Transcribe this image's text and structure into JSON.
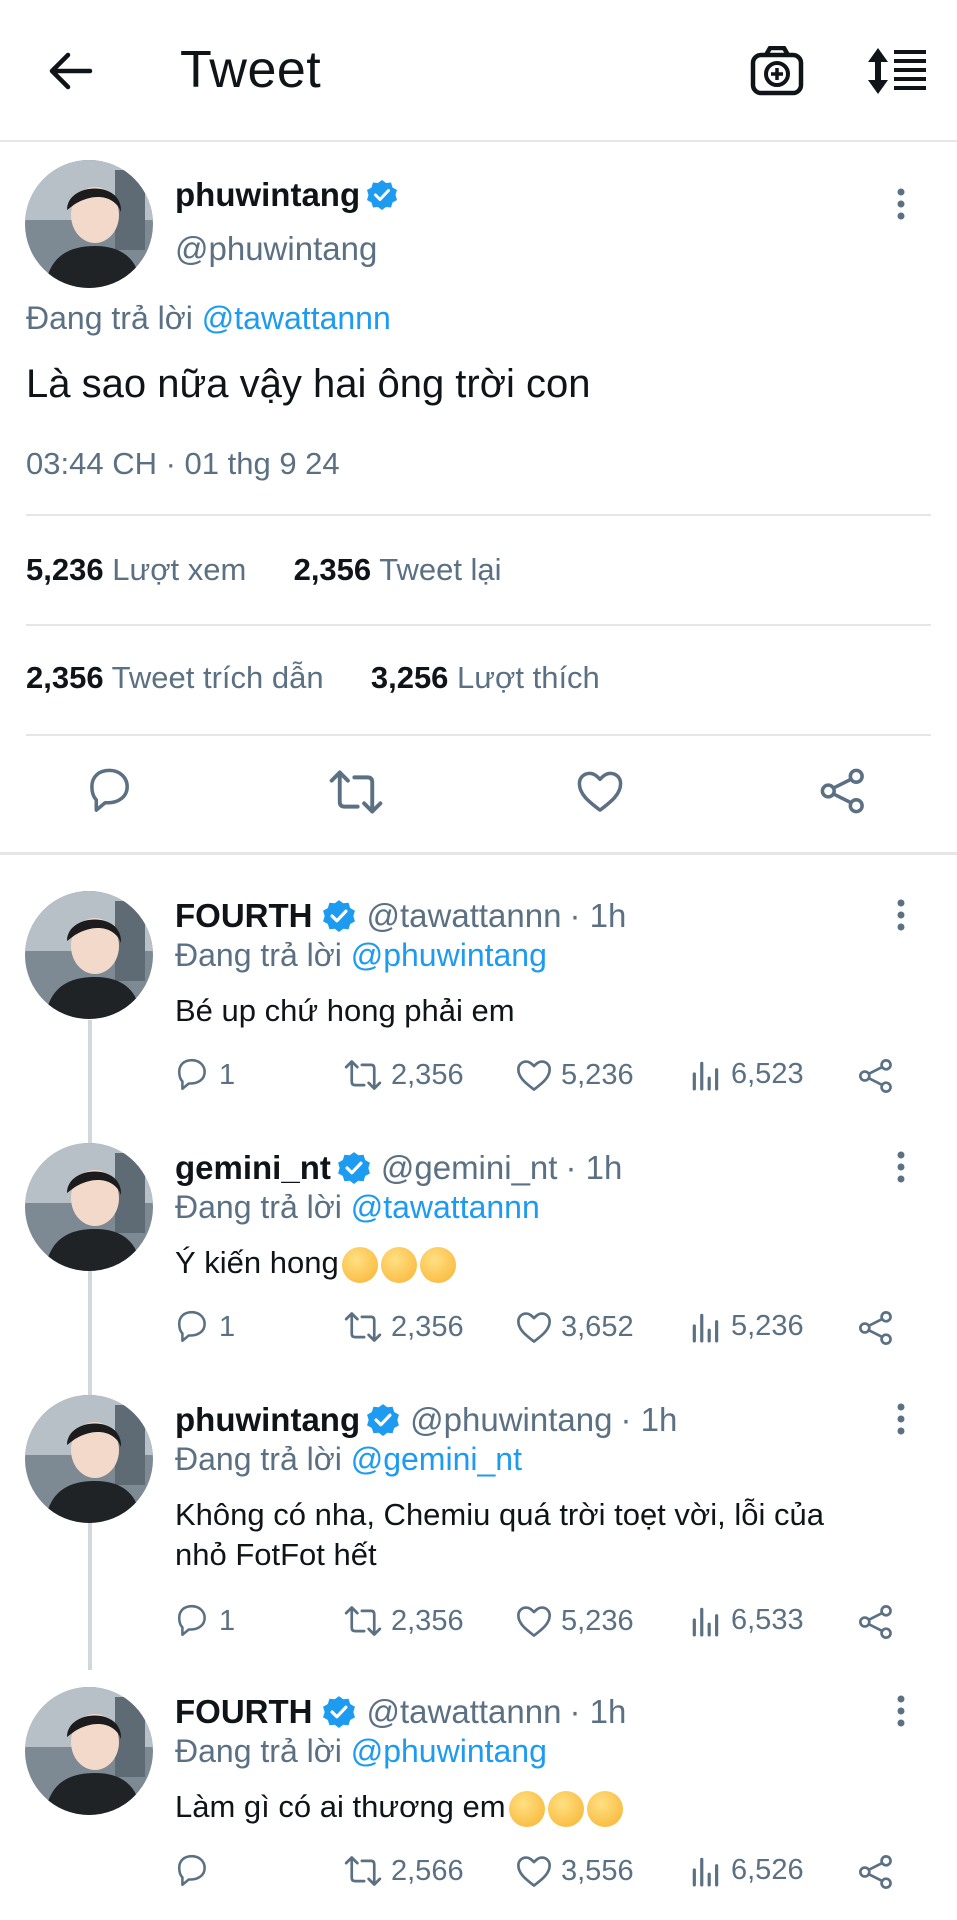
{
  "header": {
    "title": "Tweet",
    "icons": [
      "back-arrow-icon",
      "camera-plus-icon",
      "sort-icon"
    ]
  },
  "colors": {
    "accent": "#1d9bf0",
    "text": "#0f1419",
    "muted": "#5b7083",
    "divider": "#e6e6e6"
  },
  "main_tweet": {
    "name": "phuwintang",
    "handle": "@phuwintang",
    "replying_prefix": "Đang trả lời",
    "replying_to": "@tawattannn",
    "text": "Là sao nữa vậy hai ông trời con",
    "timestamp": "03:44 CH · 01 thg 9 24",
    "stats": {
      "views_count": "5,236",
      "views_label": "Lượt xem",
      "retweets_count": "2,356",
      "retweets_label": "Tweet lại",
      "quotes_count": "2,356",
      "quotes_label": "Tweet trích dẫn",
      "likes_count": "3,256",
      "likes_label": "Lượt thích"
    }
  },
  "replies": [
    {
      "name": "FOURTH",
      "handle": "@tawattannn",
      "time": "· 1h",
      "replying_prefix": "Đang trả lời",
      "replying_to": "@phuwintang",
      "text": "Bé up chứ hong phải em",
      "reply_count": "1",
      "retweet_count": "2,356",
      "like_count": "5,236",
      "view_count": "6,523"
    },
    {
      "name": "gemini_nt",
      "handle": "@gemini_nt",
      "time": "· 1h",
      "replying_prefix": "Đang trả lời",
      "replying_to": "@tawattannn",
      "text": "Ý kiến hong",
      "emoji": "pleading-face x3",
      "reply_count": "1",
      "retweet_count": "2,356",
      "like_count": "3,652",
      "view_count": "5,236"
    },
    {
      "name": "phuwintang",
      "handle": "@phuwintang",
      "time": "· 1h",
      "replying_prefix": "Đang trả lời",
      "replying_to": "@gemini_nt",
      "text_line1": "Không có nha, Chemiu quá trời toẹt vời, lỗi của",
      "text_line2": "nhỏ FotFot hết",
      "reply_count": "1",
      "retweet_count": "2,356",
      "like_count": "5,236",
      "view_count": "6,533"
    },
    {
      "name": "FOURTH",
      "handle": "@tawattannn",
      "time": "· 1h",
      "replying_prefix": "Đang trả lời",
      "replying_to": "@phuwintang",
      "text": "Làm gì có ai thương em",
      "emoji": "hugging-face x3",
      "reply_count": "",
      "retweet_count": "2,566",
      "like_count": "3,556",
      "view_count": "6,526"
    }
  ]
}
